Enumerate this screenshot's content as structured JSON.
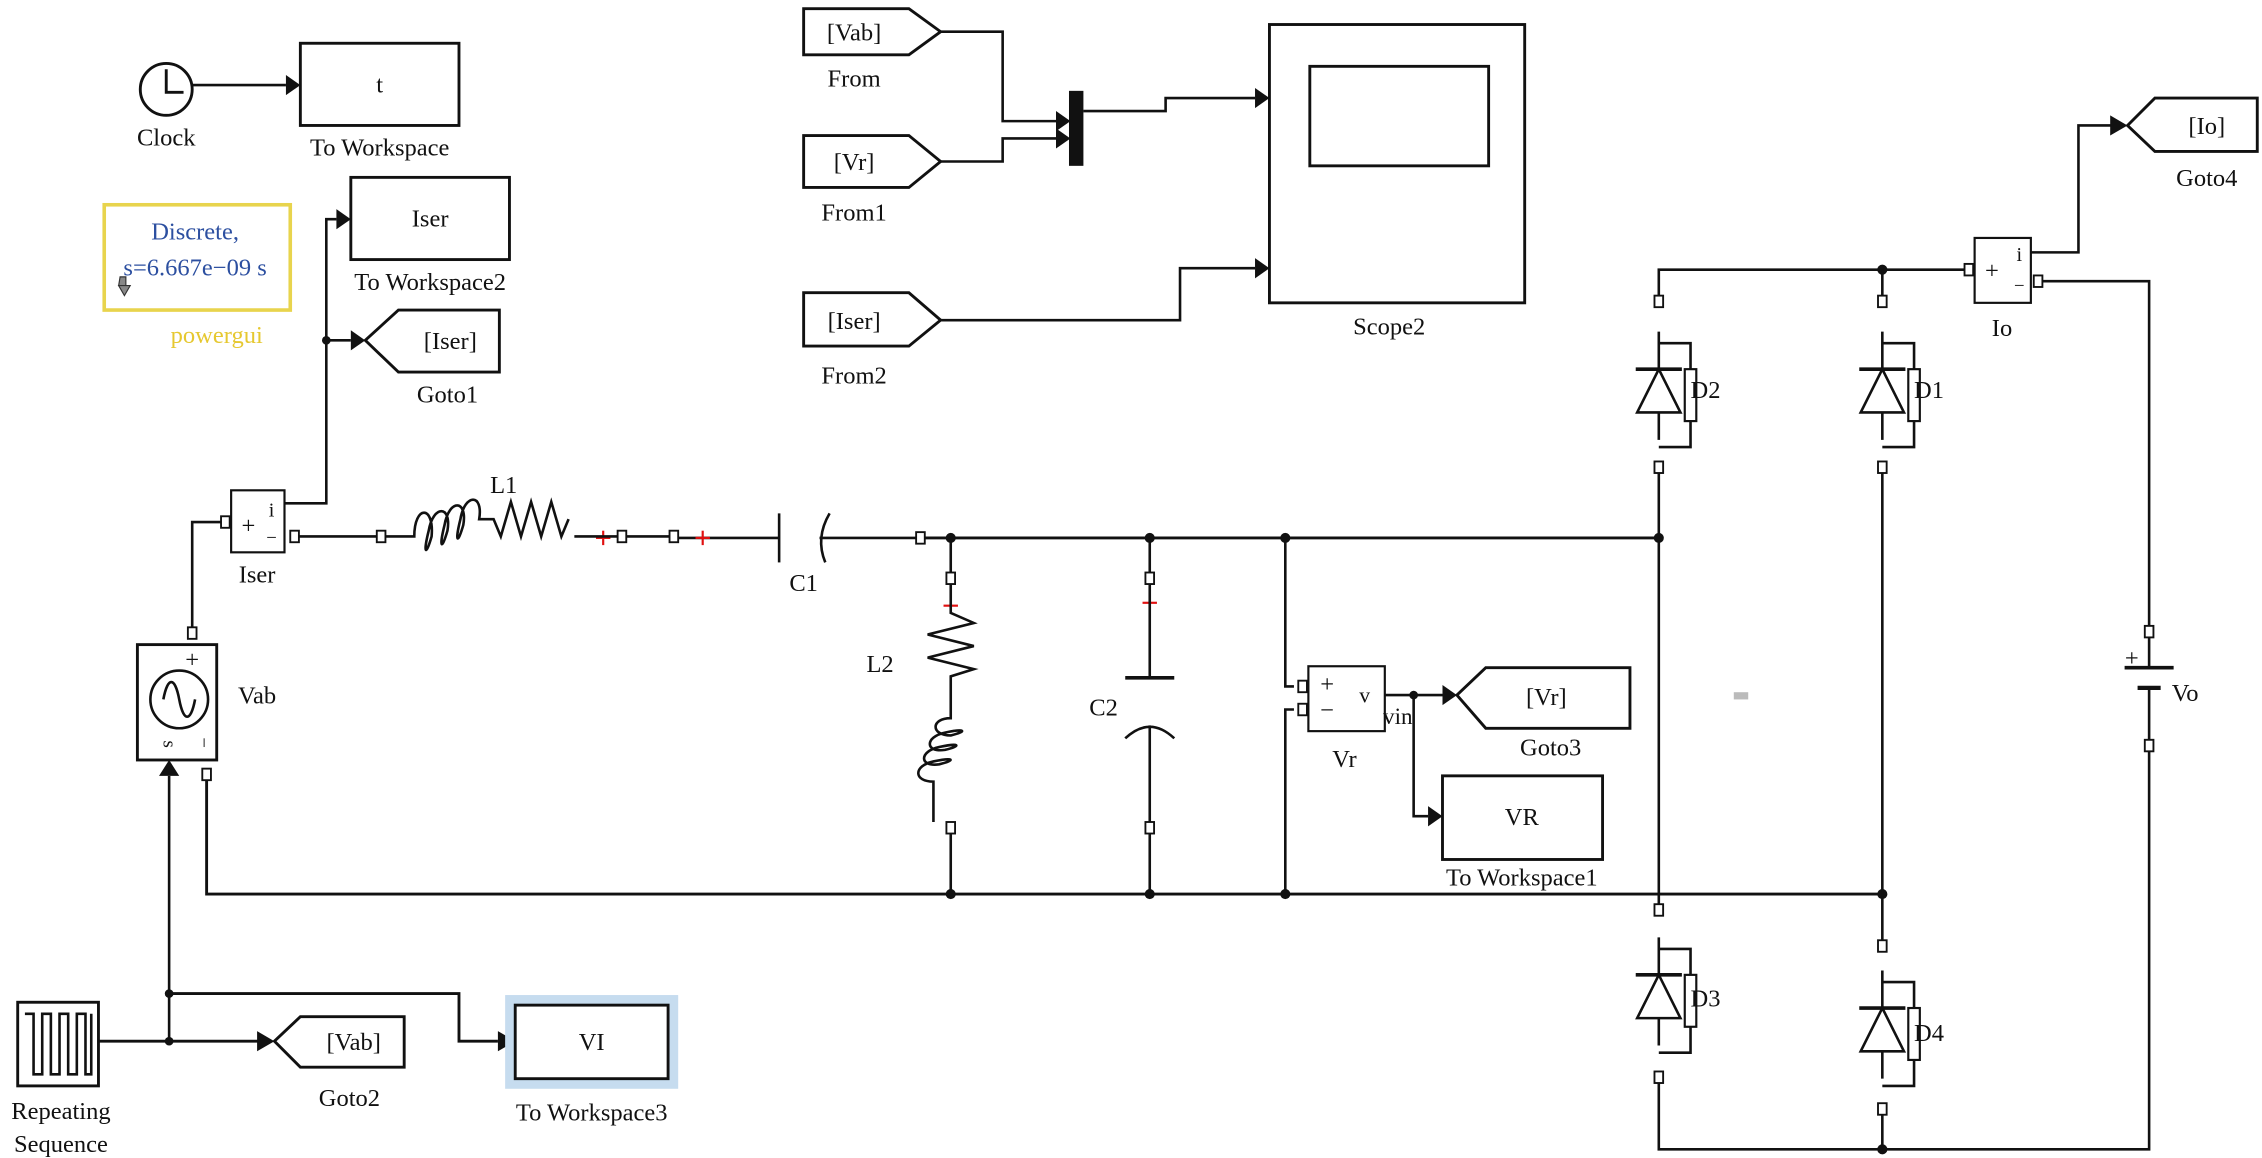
{
  "colors": {
    "powergui_border": "#e8d44d",
    "powergui_text": "#2c4fa0",
    "powergui_label": "#e6c830",
    "selection_highlight": "#c6dcef",
    "polarity_mark": "#e01010"
  },
  "blocks": {
    "clock": {
      "label": "Clock",
      "icon": "clock-icon"
    },
    "to_workspace": {
      "value": "t",
      "label": "To Workspace"
    },
    "powergui": {
      "line1": "Discrete,",
      "line2": "s=6.667e−09 s",
      "label": "powergui"
    },
    "to_workspace2": {
      "value": "Iser",
      "label": "To Workspace2"
    },
    "goto1": {
      "tag": "[Iser]",
      "label": "Goto1"
    },
    "iser": {
      "label": "Iser",
      "plus": "+",
      "minus": "−",
      "out": "i"
    },
    "l1": {
      "label": "L1"
    },
    "c1": {
      "label": "C1"
    },
    "l2": {
      "label": "L2"
    },
    "c2": {
      "label": "C2"
    },
    "vab": {
      "label": "Vab",
      "plus": "+",
      "minus": "−",
      "s": "s"
    },
    "vr": {
      "label": "Vr",
      "plus": "+",
      "minus": "−",
      "out": "v",
      "signal": "vin"
    },
    "goto3": {
      "tag": "[Vr]",
      "label": "Goto3"
    },
    "to_workspace1": {
      "value": "VR",
      "label": "To Workspace1"
    },
    "repeating_sequence": {
      "label1": "Repeating",
      "label2": "Sequence"
    },
    "goto2": {
      "tag": "[Vab]",
      "label": "Goto2"
    },
    "to_workspace3": {
      "value": "VI",
      "label": "To Workspace3"
    },
    "from": {
      "tag": "[Vab]",
      "label": "From"
    },
    "from1": {
      "tag": "[Vr]",
      "label": "From1"
    },
    "from2": {
      "tag": "[Iser]",
      "label": "From2"
    },
    "scope2": {
      "label": "Scope2"
    },
    "io": {
      "label": "Io",
      "plus": "+",
      "minus": "−",
      "out": "i"
    },
    "goto4": {
      "tag": "[Io]",
      "label": "Goto4"
    },
    "vo": {
      "label": "Vo",
      "plus": "+"
    },
    "d1": {
      "label": "D1"
    },
    "d2": {
      "label": "D2"
    },
    "d3": {
      "label": "D3"
    },
    "d4": {
      "label": "D4"
    }
  }
}
